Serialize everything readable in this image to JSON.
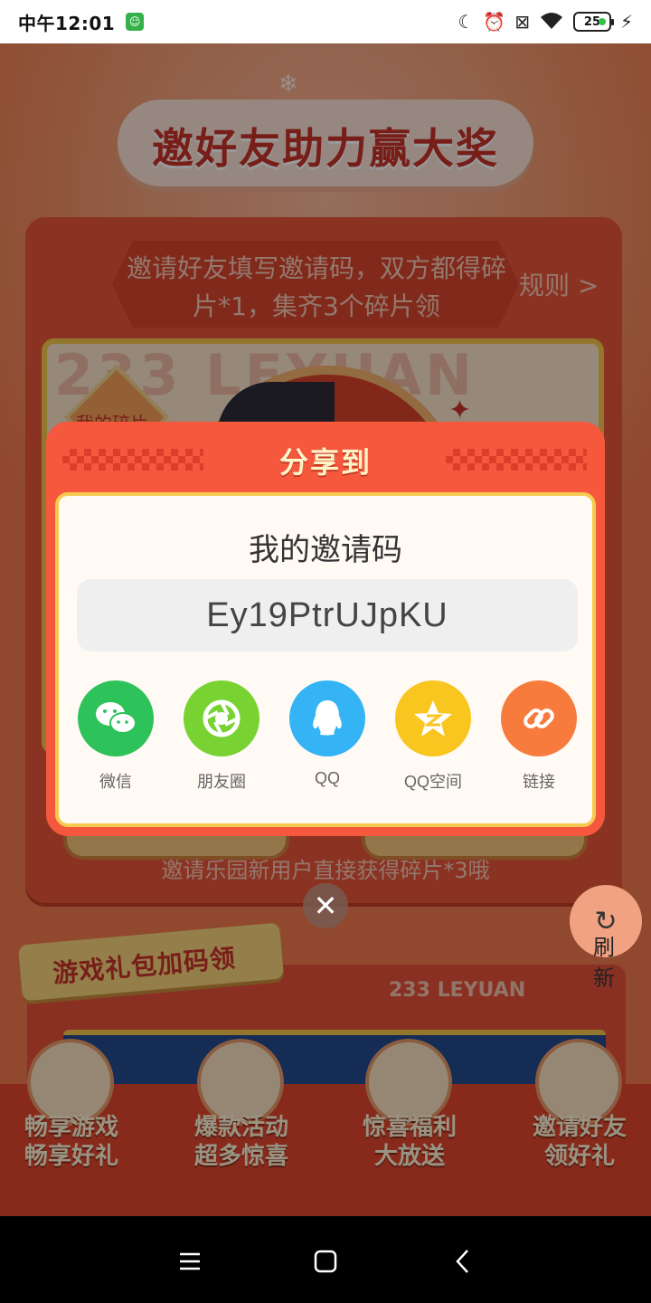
{
  "status_bar": {
    "time": "中午12:01",
    "battery_level": "25",
    "icons": [
      "moon-icon",
      "alarm-icon",
      "sim-off-icon",
      "wifi-icon",
      "battery-icon",
      "charging-icon"
    ]
  },
  "background": {
    "banner_title": "邀好友助力赢大奖",
    "rule_text": "邀请好友填写邀请码，双方都得碎片*1，集齐3个碎片领",
    "rule_link": "规则 >",
    "panel_watermark": "233 LEYUAN",
    "panel_label": "我的碎片",
    "invite_hint": "邀请乐园新用户直接获得碎片*3哦",
    "gift_title": "游戏礼包加码领",
    "gift_brand": "233 LEYUAN",
    "features": [
      {
        "line1": "畅享游戏",
        "line2": "畅享好礼"
      },
      {
        "line1": "爆款活动",
        "line2": "超多惊喜"
      },
      {
        "line1": "惊喜福利",
        "line2": "大放送"
      },
      {
        "line1": "邀请好友",
        "line2": "领好礼"
      }
    ],
    "refresh": {
      "label_1": "刷",
      "label_2": "新"
    }
  },
  "share_modal": {
    "title": "分享到",
    "code_label": "我的邀请码",
    "invite_code": "Ey19PtrUJpKU",
    "targets": [
      {
        "label": "微信",
        "icon": "wechat-icon",
        "color": "#2dc25a"
      },
      {
        "label": "朋友圈",
        "icon": "moments-icon",
        "color": "#78d232"
      },
      {
        "label": "QQ",
        "icon": "qq-icon",
        "color": "#34b4f4"
      },
      {
        "label": "QQ空间",
        "icon": "qzone-icon",
        "color": "#f9c51f"
      },
      {
        "label": "链接",
        "icon": "link-icon",
        "color": "#f77b3c"
      }
    ]
  },
  "colors": {
    "modal_red": "#f6583d",
    "accent_yellow": "#f6c94f",
    "page_orange": "#f07a4e"
  }
}
